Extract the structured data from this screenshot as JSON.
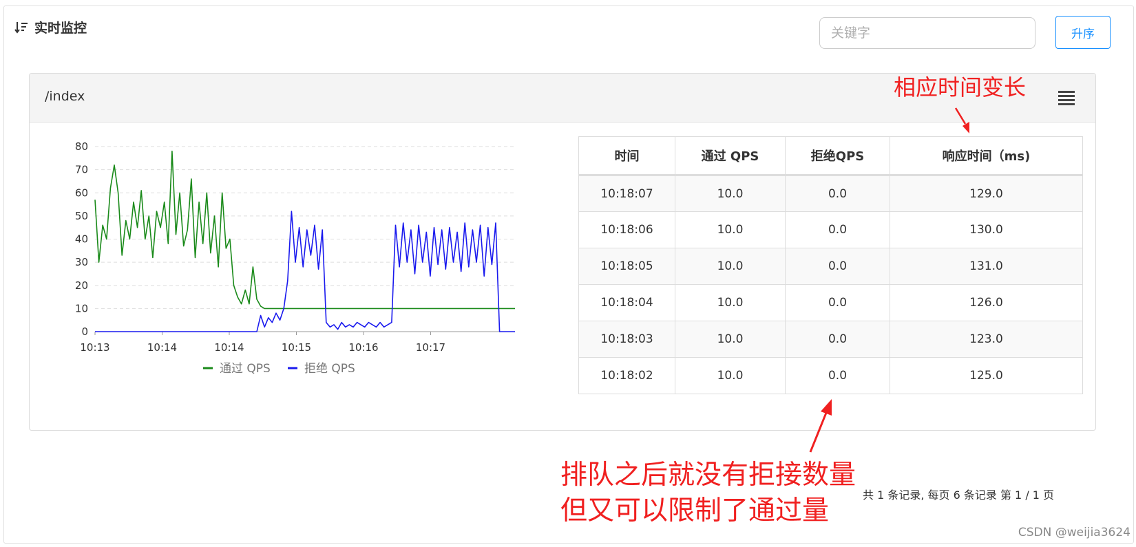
{
  "header": {
    "title": "实时监控",
    "sort_icon": "sort-descending-icon"
  },
  "search": {
    "placeholder": "关键字"
  },
  "sort_button": {
    "label": "升序"
  },
  "card": {
    "title": "/index",
    "menu_icon": "hamburger-menu-icon"
  },
  "chart_data": {
    "type": "line",
    "x": [
      "10:13",
      "10:14",
      "10:14",
      "10:15",
      "10:16",
      "10:17"
    ],
    "ylim": [
      0,
      80
    ],
    "yticks": [
      0,
      10,
      20,
      30,
      40,
      50,
      60,
      70,
      80
    ],
    "grid": true,
    "legend_placement": "bottom",
    "series": [
      {
        "name": "通过 QPS",
        "color": "#1a8a1a",
        "values": [
          57,
          30,
          46,
          40,
          62,
          72,
          60,
          33,
          48,
          40,
          56,
          45,
          61,
          40,
          50,
          32,
          52,
          45,
          56,
          38,
          78,
          42,
          60,
          37,
          44,
          66,
          32,
          56,
          38,
          60,
          34,
          50,
          28,
          60,
          36,
          40,
          20,
          15,
          12,
          18,
          12,
          28,
          14,
          11,
          10,
          10,
          10,
          10,
          10,
          10,
          10,
          10,
          10,
          10,
          10,
          10,
          10,
          10,
          10,
          10,
          10,
          10,
          10,
          10,
          10,
          10,
          10,
          10,
          10,
          10,
          10,
          10,
          10,
          10,
          10,
          10,
          10,
          10,
          10,
          10,
          10,
          10,
          10,
          10,
          10,
          10,
          10,
          10,
          10,
          10,
          10,
          10,
          10,
          10,
          10,
          10,
          10,
          10,
          10,
          10,
          10,
          10,
          10,
          10,
          10,
          10,
          10,
          10,
          10,
          10
        ]
      },
      {
        "name": "拒绝 QPS",
        "color": "#1a1aee",
        "values": [
          0,
          0,
          0,
          0,
          0,
          0,
          0,
          0,
          0,
          0,
          0,
          0,
          0,
          0,
          0,
          0,
          0,
          0,
          0,
          0,
          0,
          0,
          0,
          0,
          0,
          0,
          0,
          0,
          0,
          0,
          0,
          0,
          0,
          0,
          0,
          0,
          0,
          0,
          0,
          0,
          0,
          0,
          0,
          7,
          2,
          6,
          4,
          8,
          5,
          10,
          22,
          52,
          30,
          45,
          28,
          44,
          33,
          46,
          27,
          44,
          4,
          2,
          3,
          1,
          4,
          2,
          3,
          2,
          4,
          3,
          2,
          4,
          3,
          2,
          4,
          2,
          3,
          4,
          46,
          28,
          47,
          30,
          44,
          25,
          46,
          30,
          43,
          24,
          45,
          29,
          44,
          27,
          45,
          30,
          43,
          26,
          47,
          28,
          44,
          30,
          46,
          24,
          45,
          29,
          47,
          0,
          0,
          0,
          0,
          0
        ]
      }
    ]
  },
  "table": {
    "columns": [
      "时间",
      "通过 QPS",
      "拒绝QPS",
      "响应时间（ms)"
    ],
    "rows": [
      [
        "10:18:07",
        "10.0",
        "0.0",
        "129.0"
      ],
      [
        "10:18:06",
        "10.0",
        "0.0",
        "130.0"
      ],
      [
        "10:18:05",
        "10.0",
        "0.0",
        "131.0"
      ],
      [
        "10:18:04",
        "10.0",
        "0.0",
        "126.0"
      ],
      [
        "10:18:03",
        "10.0",
        "0.0",
        "123.0"
      ],
      [
        "10:18:02",
        "10.0",
        "0.0",
        "125.0"
      ]
    ]
  },
  "pagination": {
    "text": "共 1 条记录, 每页 6 条记录 第 1 / 1 页"
  },
  "annotations": {
    "top": "相应时间变长",
    "bottom_line1": "排队之后就没有拒接数量",
    "bottom_line2": "但又可以限制了通过量",
    "color": "#f02020"
  },
  "watermark": "CSDN @weijia3624"
}
